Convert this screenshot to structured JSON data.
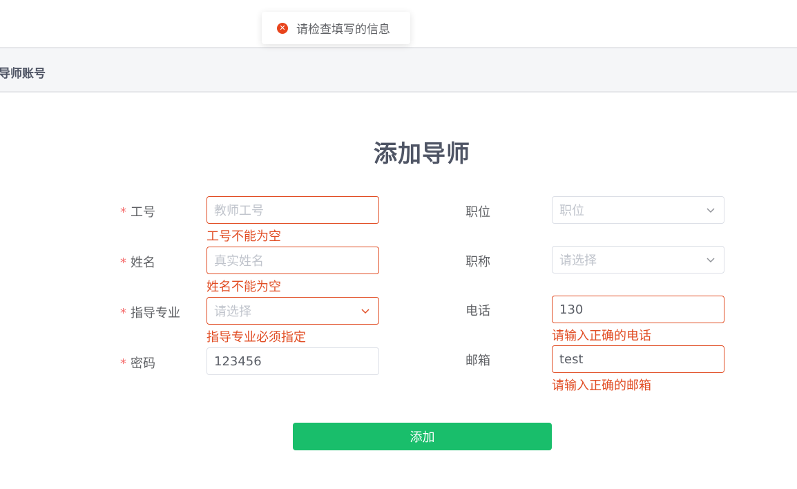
{
  "toast": {
    "message": "请检查填写的信息",
    "icon": "error-circle-icon"
  },
  "header": {
    "title": "导师账号"
  },
  "form": {
    "title": "添加导师",
    "left": [
      {
        "label": "工号",
        "required": true,
        "placeholder": "教师工号",
        "value": "",
        "error": "工号不能为空"
      },
      {
        "label": "姓名",
        "required": true,
        "placeholder": "真实姓名",
        "value": "",
        "error": "姓名不能为空"
      },
      {
        "label": "指导专业",
        "required": true,
        "placeholder": "请选择",
        "value": "",
        "error": "指导专业必须指定"
      },
      {
        "label": "密码",
        "required": true,
        "placeholder": "",
        "value": "123456",
        "error": ""
      }
    ],
    "right": [
      {
        "label": "职位",
        "placeholder": "职位",
        "value": ""
      },
      {
        "label": "职称",
        "placeholder": "请选择",
        "value": ""
      },
      {
        "label": "电话",
        "placeholder": "",
        "value": "130",
        "error": "请输入正确的电话"
      },
      {
        "label": "邮箱",
        "placeholder": "",
        "value": "test",
        "error": "请输入正确的邮箱"
      }
    ],
    "required_mark": "*",
    "submit_label": "添加"
  },
  "colors": {
    "error": "#e14d24",
    "primary_button": "#19be6b",
    "title": "#4f5565"
  }
}
